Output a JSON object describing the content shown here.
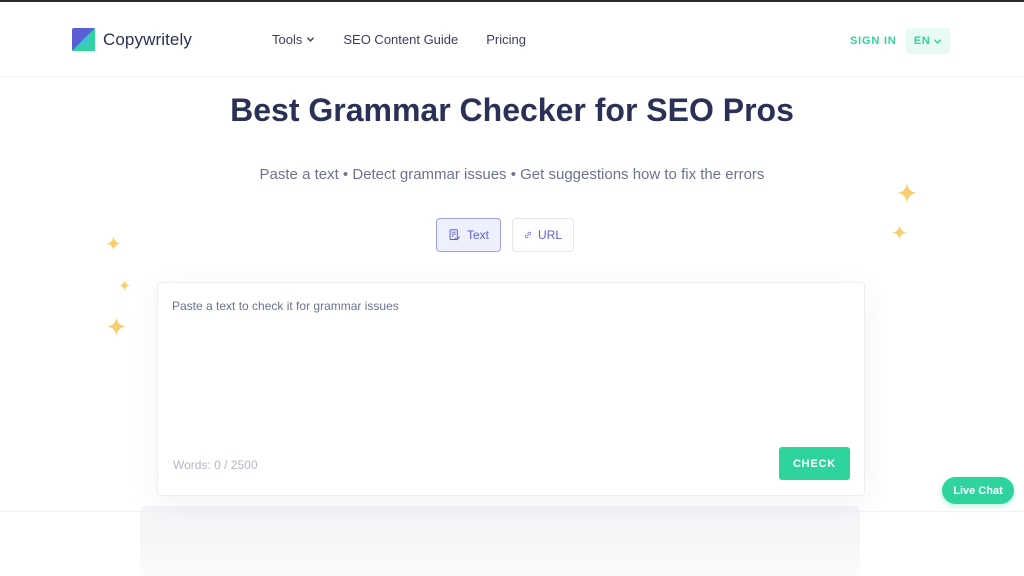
{
  "brand": {
    "name": "Copywritely"
  },
  "nav": {
    "items": [
      {
        "label": "Tools",
        "has_dropdown": true
      },
      {
        "label": "SEO Content Guide",
        "has_dropdown": false
      },
      {
        "label": "Pricing",
        "has_dropdown": false
      }
    ],
    "sign_in": "SIGN IN",
    "language": "EN"
  },
  "hero": {
    "title": "Best Grammar Checker for SEO Pros",
    "subtitle": "Paste a text • Detect grammar issues • Get suggestions how to fix the errors"
  },
  "modes": {
    "active": "Text",
    "items": [
      {
        "label": "Text",
        "icon": "document-check-icon"
      },
      {
        "label": "URL",
        "icon": "link-icon"
      }
    ]
  },
  "editor": {
    "value": "",
    "placeholder": "Paste a text to check it for grammar issues",
    "word_count": "Words: 0 / 2500",
    "check_label": "CHECK"
  },
  "live_chat": {
    "label": "Live Chat"
  },
  "colors": {
    "accent_green": "#2fd39d",
    "accent_purple": "#5b5fd6",
    "heading": "#2b3156",
    "sparkle": "#f7cf6e"
  }
}
